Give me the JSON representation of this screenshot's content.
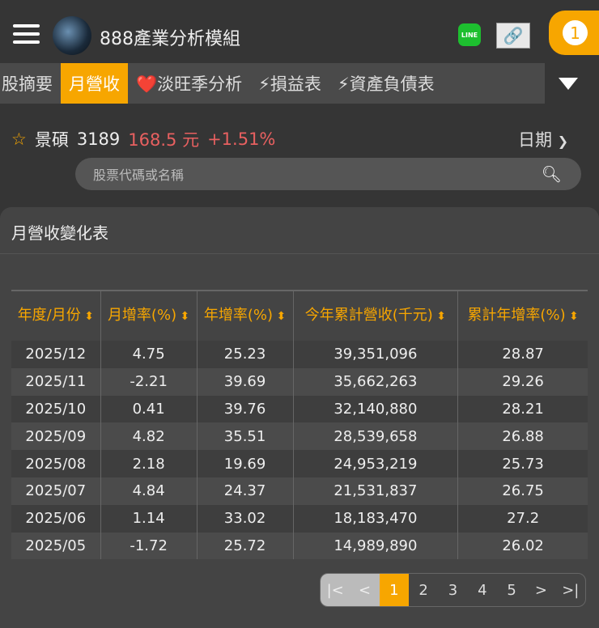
{
  "header": {
    "title": "888產業分析模組",
    "line_label": "LINE",
    "notification_count": "1"
  },
  "tabs": [
    {
      "label": "股摘要"
    },
    {
      "label": "月營收",
      "active": true
    },
    {
      "label": "❤️淡旺季分析"
    },
    {
      "label": "⚡損益表"
    },
    {
      "label": "⚡資產負債表"
    }
  ],
  "stock": {
    "name": "景碩",
    "code": "3189",
    "price": "168.5 元",
    "change": "+1.51%",
    "sort_label": "日期"
  },
  "search": {
    "placeholder": "股票代碼或名稱"
  },
  "card": {
    "title": "月營收變化表"
  },
  "table": {
    "headers": [
      "年度/月份",
      "月增率(%)",
      "年增率(%)",
      "今年累計營收(千元)",
      "累計年增率(%)"
    ],
    "rows": [
      [
        "2025/12",
        "4.75",
        "25.23",
        "39,351,096",
        "28.87"
      ],
      [
        "2025/11",
        "-2.21",
        "39.69",
        "35,662,263",
        "29.26"
      ],
      [
        "2025/10",
        "0.41",
        "39.76",
        "32,140,880",
        "28.21"
      ],
      [
        "2025/09",
        "4.82",
        "35.51",
        "28,539,658",
        "26.88"
      ],
      [
        "2025/08",
        "2.18",
        "19.69",
        "24,953,219",
        "25.73"
      ],
      [
        "2025/07",
        "4.84",
        "24.37",
        "21,531,837",
        "26.75"
      ],
      [
        "2025/06",
        "1.14",
        "33.02",
        "18,183,470",
        "27.2"
      ],
      [
        "2025/05",
        "-1.72",
        "25.72",
        "14,989,890",
        "26.02"
      ]
    ]
  },
  "pagination": {
    "first": "|<",
    "prev": "<",
    "pages": [
      "1",
      "2",
      "3",
      "4",
      "5"
    ],
    "current": "1",
    "next": ">",
    "last": ">|"
  }
}
